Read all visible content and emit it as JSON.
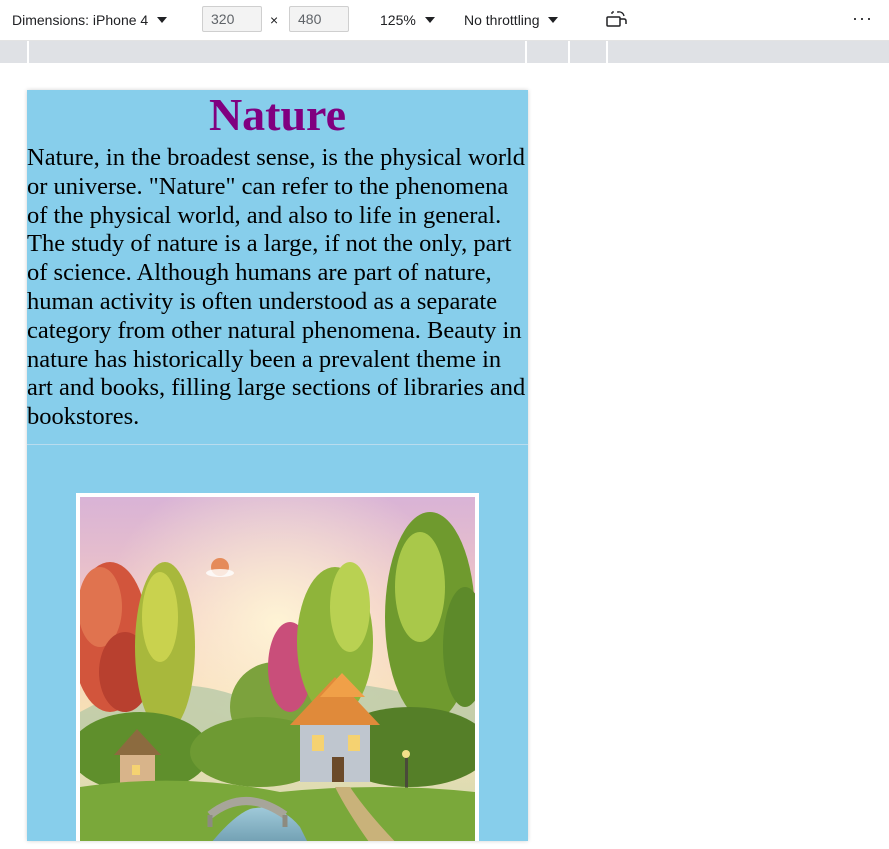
{
  "devtools": {
    "dimensions_label": "Dimensions: iPhone 4",
    "width_value": "320",
    "height_value": "480",
    "times_symbol": "×",
    "zoom": "125%",
    "throttling": "No throttling",
    "more_symbol": "···"
  },
  "page": {
    "heading": "Nature",
    "paragraph": "Nature, in the broadest sense, is the physical world or universe. \"Nature\" can refer to the phenomena of the physical world, and also to life in general. The study of nature is a large, if not the only, part of science. Although humans are part of nature, human activity is often understood as a separate category from other natural phenomena. Beauty in nature has historically been a prevalent theme in art and books, filling large sections of libraries and bookstores."
  },
  "colors": {
    "page_background": "#87ceeb",
    "heading": "#800080",
    "text": "#000000"
  },
  "icons": {
    "dimensions_dropdown": "chevron-down-icon",
    "zoom_dropdown": "chevron-down-icon",
    "throttling_dropdown": "chevron-down-icon",
    "rotate": "rotate-device-icon",
    "more": "more-options-icon"
  }
}
